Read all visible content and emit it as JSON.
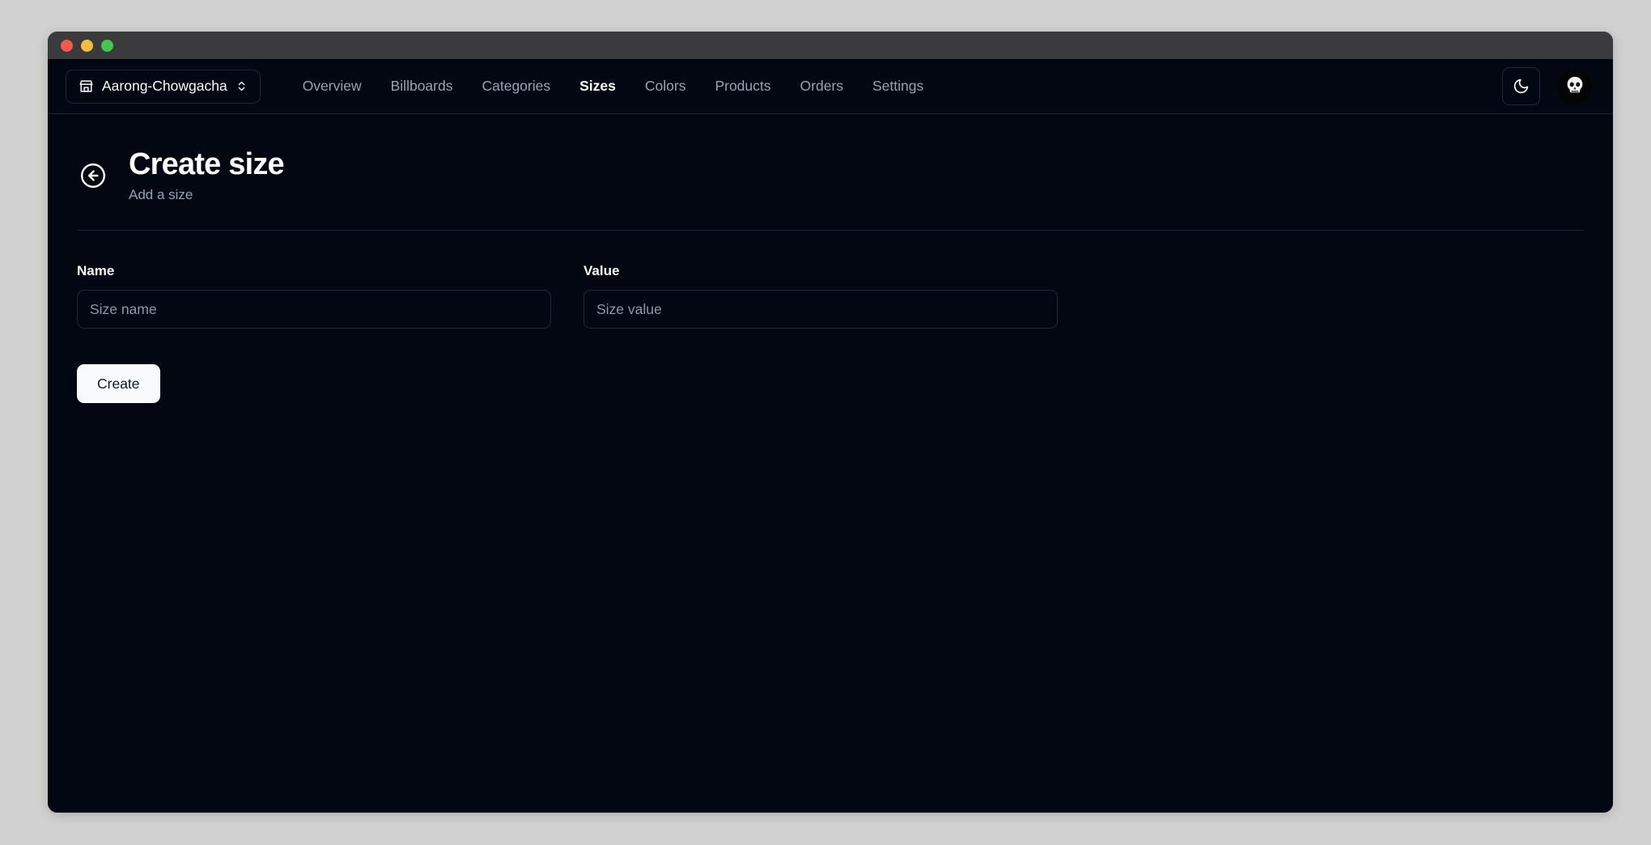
{
  "window": {
    "traffic_lights": [
      "close",
      "minimize",
      "maximize"
    ],
    "chrome_color": "#3b3b3d",
    "page_background": "#d1d1d1",
    "app_background": "#030712"
  },
  "navbar": {
    "store_switcher": {
      "label": "Aarong-Chowgacha",
      "leading_icon": "store-icon",
      "trailing_icon": "chevrons-up-down-icon"
    },
    "links": [
      {
        "label": "Overview",
        "active": false
      },
      {
        "label": "Billboards",
        "active": false
      },
      {
        "label": "Categories",
        "active": false
      },
      {
        "label": "Sizes",
        "active": true
      },
      {
        "label": "Colors",
        "active": false
      },
      {
        "label": "Products",
        "active": false
      },
      {
        "label": "Orders",
        "active": false
      },
      {
        "label": "Settings",
        "active": false
      }
    ],
    "theme_toggle": {
      "icon": "moon-icon",
      "mode": "dark"
    },
    "avatar": {
      "icon": "skull-avatar-icon"
    }
  },
  "page": {
    "back_icon": "arrow-left-circle-icon",
    "title": "Create size",
    "subtitle": "Add a size"
  },
  "form": {
    "fields": [
      {
        "label": "Name",
        "placeholder": "Size name",
        "value": ""
      },
      {
        "label": "Value",
        "placeholder": "Size value",
        "value": ""
      }
    ],
    "submit_label": "Create"
  },
  "colors": {
    "accent_white": "#f8fafc",
    "muted_text": "#9aa3b2",
    "border": "#1f2738",
    "background": "#030712"
  }
}
